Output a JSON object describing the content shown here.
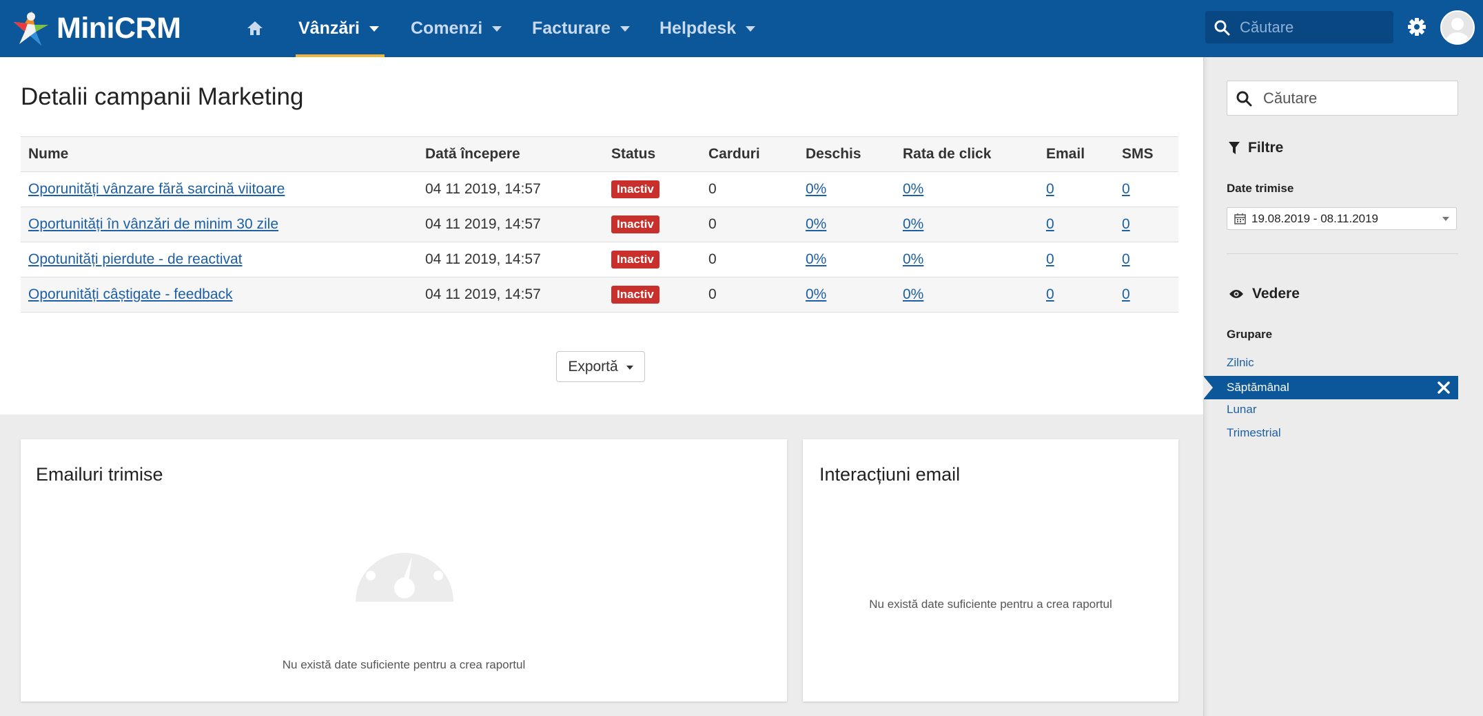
{
  "app": {
    "brand": "MiniCRM"
  },
  "nav": {
    "items": [
      {
        "label": "Vânzări",
        "active": true
      },
      {
        "label": "Comenzi",
        "active": false
      },
      {
        "label": "Facturare",
        "active": false
      },
      {
        "label": "Helpdesk",
        "active": false
      }
    ],
    "search_placeholder": "Căutare"
  },
  "page": {
    "title": "Detalii campanii Marketing"
  },
  "table": {
    "columns": [
      "Nume",
      "Dată începere",
      "Status",
      "Carduri",
      "Deschis",
      "Rata de click",
      "Email",
      "SMS"
    ],
    "rows": [
      {
        "name": "Oporunități vânzare fără sarcină viitoare",
        "start": "04 11 2019, 14:57",
        "status": "Inactiv",
        "cards": "0",
        "opened": "0%",
        "click_rate": "0%",
        "email": "0",
        "sms": "0"
      },
      {
        "name": "Oportunități în vânzări de minim 30 zile",
        "start": "04 11 2019, 14:57",
        "status": "Inactiv",
        "cards": "0",
        "opened": "0%",
        "click_rate": "0%",
        "email": "0",
        "sms": "0"
      },
      {
        "name": "Opotunități pierdute - de reactivat",
        "start": "04 11 2019, 14:57",
        "status": "Inactiv",
        "cards": "0",
        "opened": "0%",
        "click_rate": "0%",
        "email": "0",
        "sms": "0"
      },
      {
        "name": "Oporunități câștigate - feedback",
        "start": "04 11 2019, 14:57",
        "status": "Inactiv",
        "cards": "0",
        "opened": "0%",
        "click_rate": "0%",
        "email": "0",
        "sms": "0"
      }
    ],
    "export_label": "Exportă"
  },
  "reports": {
    "emails_sent": {
      "title": "Emailuri trimise",
      "empty": "Nu există date suficiente pentru a crea raportul"
    },
    "email_interactions": {
      "title": "Interacțiuni email",
      "empty": "Nu există date suficiente pentru a crea raportul"
    }
  },
  "sidebar": {
    "search_placeholder": "Căutare",
    "filters_title": "Filtre",
    "date_label": "Date trimise",
    "date_range": "19.08.2019 - 08.11.2019",
    "view_title": "Vedere",
    "group_label": "Grupare",
    "group_options": [
      "Zilnic",
      "Săptămânal",
      "Lunar",
      "Trimestrial"
    ],
    "group_selected": "Săptămânal"
  },
  "colors": {
    "navbar": "#0b5799",
    "nav_underline": "#f0b43c",
    "badge_inactive": "#c9302c",
    "link": "#1d5fa3"
  }
}
